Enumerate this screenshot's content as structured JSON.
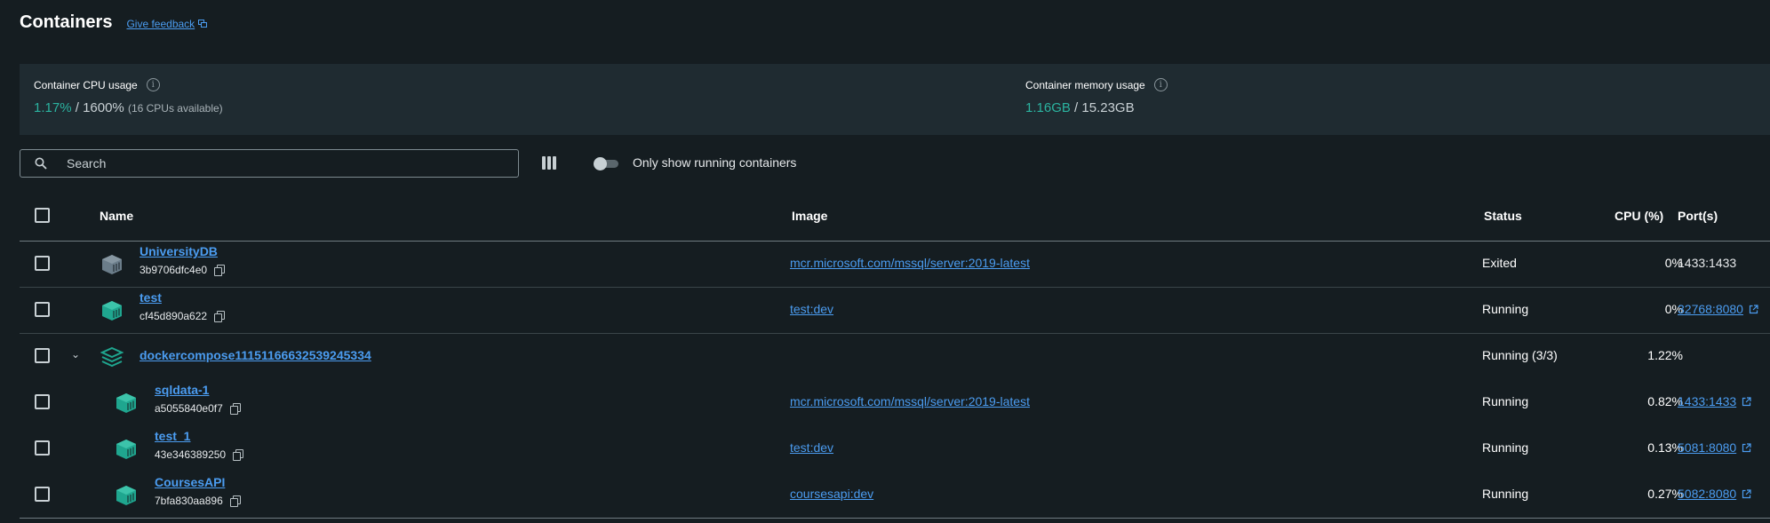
{
  "header": {
    "title": "Containers",
    "feedback_label": "Give feedback"
  },
  "stats": {
    "cpu": {
      "label": "Container CPU usage",
      "used": "1.17%",
      "sep": " / ",
      "total": "1600%",
      "note": "(16 CPUs available)"
    },
    "memory": {
      "label": "Container memory usage",
      "used": "1.16GB",
      "sep": " / ",
      "total": "15.23GB"
    }
  },
  "toolbar": {
    "search_placeholder": "Search",
    "toggle_label": "Only show running containers",
    "toggle_on": false
  },
  "table": {
    "columns": {
      "name": "Name",
      "image": "Image",
      "status": "Status",
      "cpu": "CPU (%)",
      "ports": "Port(s)"
    },
    "rows": [
      {
        "name": "UniversityDB",
        "id": "3b9706dfc4e0",
        "image": "mcr.microsoft.com/mssql/server:2019-latest",
        "status": "Exited",
        "cpu": "0%",
        "port": "1433:1433",
        "port_link": false,
        "icon_color": "#6b7d8a"
      },
      {
        "name": "test",
        "id": "cf45d890a622",
        "image": "test:dev",
        "status": "Running",
        "cpu": "0%",
        "port": "32768:8080",
        "port_link": true,
        "icon_color": "#1fa68f"
      },
      {
        "name": "dockercompose11151166632539245334",
        "status": "Running (3/3)",
        "cpu": "1.22%",
        "is_group": true,
        "icon_color": "#1fa68f"
      },
      {
        "name": "sqldata-1",
        "id": "a5055840e0f7",
        "image": "mcr.microsoft.com/mssql/server:2019-latest",
        "status": "Running",
        "cpu": "0.82%",
        "port": "1433:1433",
        "port_link": true,
        "icon_color": "#1fa68f"
      },
      {
        "name": "test_1",
        "id": "43e346389250",
        "image": "test:dev",
        "status": "Running",
        "cpu": "0.13%",
        "port": "5081:8080",
        "port_link": true,
        "icon_color": "#1fa68f"
      },
      {
        "name": "CoursesAPI",
        "id": "7bfa830aa896",
        "image": "coursesapi:dev",
        "status": "Running",
        "cpu": "0.27%",
        "port": "5082:8080",
        "port_link": true,
        "icon_color": "#1fa68f"
      }
    ]
  },
  "colors": {
    "background": "#151d21",
    "panel": "#1f2b31",
    "accent": "#2bb3a0",
    "link": "#4b9cf0"
  }
}
